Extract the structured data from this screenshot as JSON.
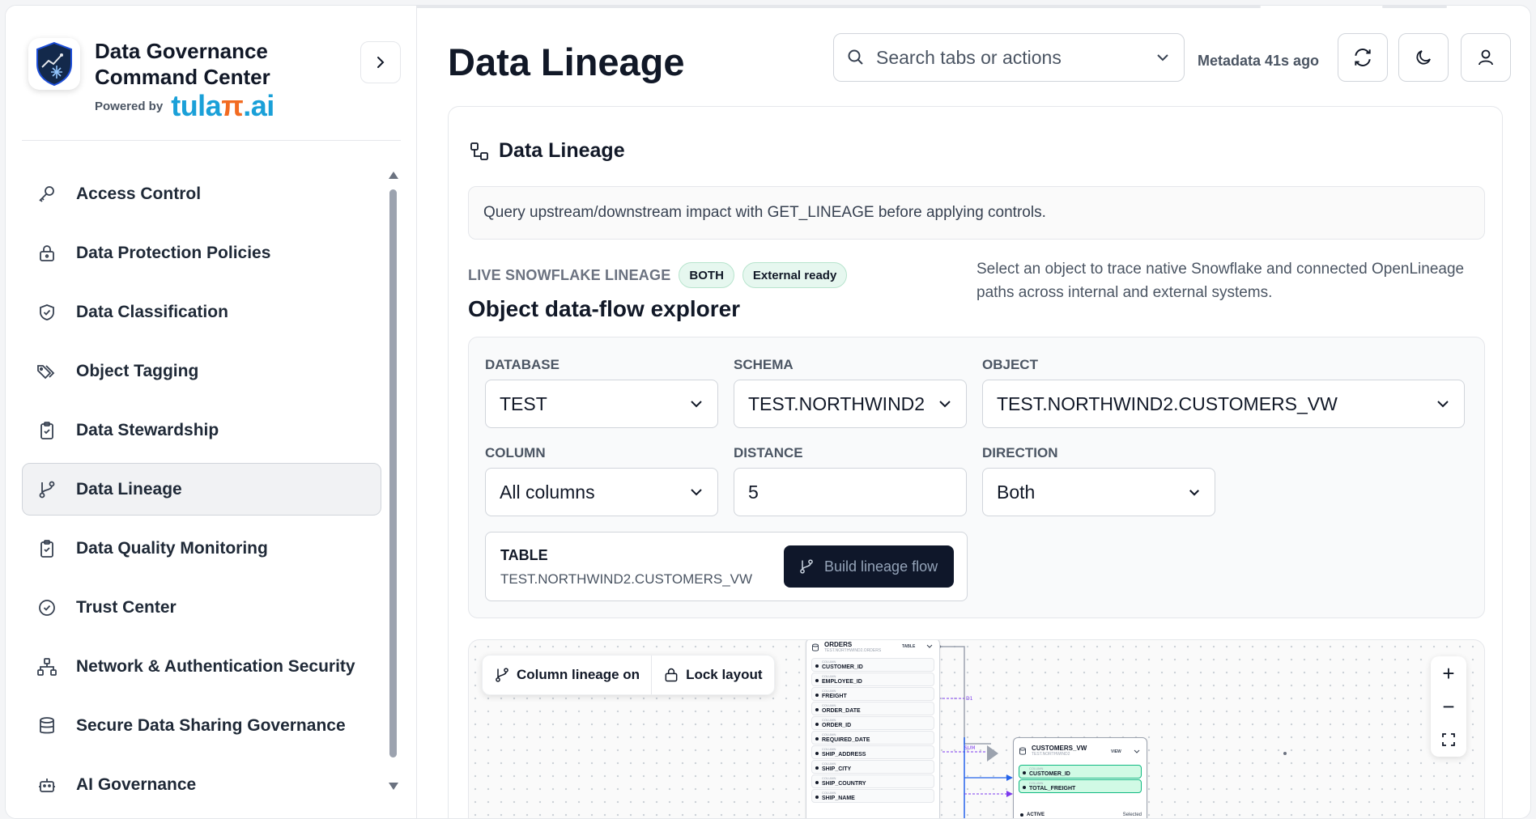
{
  "app": {
    "title_line1": "Data Governance",
    "title_line2": "Command Center",
    "powered_by": "Powered by",
    "powered_logo_a": "tula",
    "powered_logo_pi": "π",
    "powered_logo_b": ".ai"
  },
  "sidebar": {
    "items": [
      {
        "label": "Access Control",
        "icon": "key-icon"
      },
      {
        "label": "Data Protection Policies",
        "icon": "lock-icon"
      },
      {
        "label": "Data Classification",
        "icon": "shield-check-icon"
      },
      {
        "label": "Object Tagging",
        "icon": "tags-icon"
      },
      {
        "label": "Data Stewardship",
        "icon": "clipboard-check-icon"
      },
      {
        "label": "Data Lineage",
        "icon": "git-branch-icon",
        "active": true
      },
      {
        "label": "Data Quality Monitoring",
        "icon": "clipboard-check-icon"
      },
      {
        "label": "Trust Center",
        "icon": "check-circle-icon"
      },
      {
        "label": "Network & Authentication Security",
        "icon": "network-icon"
      },
      {
        "label": "Secure Data Sharing Governance",
        "icon": "database-icon"
      },
      {
        "label": "AI Governance",
        "icon": "bot-icon"
      }
    ]
  },
  "header": {
    "page_title": "Data Lineage",
    "search_placeholder": "Search tabs or actions",
    "metadata_status": "Metadata 41s ago"
  },
  "card": {
    "title": "Data Lineage",
    "info": "Query upstream/downstream impact with GET_LINEAGE before applying controls.",
    "live_label": "LIVE SNOWFLAKE LINEAGE",
    "badge_both": "BOTH",
    "badge_external": "External ready",
    "explorer_title": "Object data-flow explorer",
    "explorer_desc": "Select an object to trace native Snowflake and connected OpenLineage paths across internal and external systems."
  },
  "form": {
    "database_label": "DATABASE",
    "database_value": "TEST",
    "schema_label": "SCHEMA",
    "schema_value": "TEST.NORTHWIND2",
    "object_label": "OBJECT",
    "object_value": "TEST.NORTHWIND2.CUSTOMERS_VW",
    "column_label": "COLUMN",
    "column_value": "All columns",
    "distance_label": "DISTANCE",
    "distance_value": "5",
    "direction_label": "DIRECTION",
    "direction_value": "Both",
    "selected_type": "TABLE",
    "selected_name": "TEST.NORTHWIND2.CUSTOMERS_VW",
    "build_label": "Build lineage flow"
  },
  "graph": {
    "column_lineage_label": "Column lineage on",
    "lock_layout_label": "Lock layout",
    "zoom_in": "+",
    "zoom_out": "−",
    "orders_node": {
      "name": "ORDERS",
      "sub": "TEST.NORTHWIND2.ORDERS",
      "type": "TABLE",
      "column_kind": "COLUMN",
      "columns": [
        "CUSTOMER_ID",
        "EMPLOYEE_ID",
        "FREIGHT",
        "ORDER_DATE",
        "ORDER_ID",
        "REQUIRED_DATE",
        "SHIP_ADDRESS",
        "SHIP_CITY",
        "SHIP_COUNTRY",
        "SHIP_NAME"
      ]
    },
    "customers_node": {
      "name": "CUSTOMERS_VW",
      "sub": "TEST.NORTHWIND2",
      "type": "VIEW",
      "column_kind": "COLUMN",
      "columns": [
        "CUSTOMER_ID",
        "TOTAL_FREIGHT"
      ],
      "status": "ACTIVE",
      "selected": "Selected"
    },
    "edge_labels": {
      "d1": "D1",
      "sum": "SUM"
    }
  }
}
